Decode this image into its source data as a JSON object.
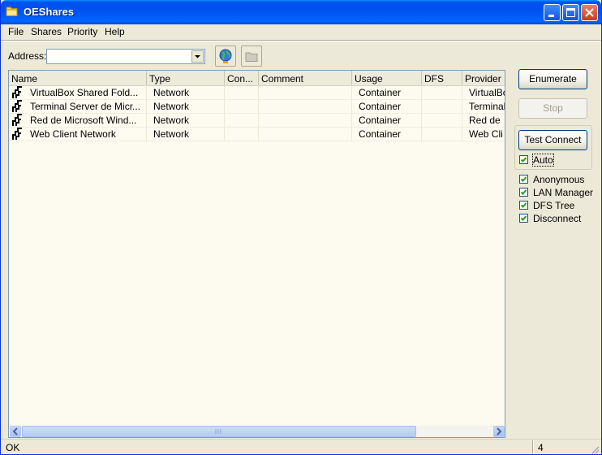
{
  "window": {
    "title": "OEShares"
  },
  "menu": [
    "File",
    "Shares",
    "Priority",
    "Help"
  ],
  "address": {
    "label": "Address:",
    "value": "",
    "placeholder": ""
  },
  "columns": [
    "Name",
    "Type",
    "Con...",
    "Comment",
    "Usage",
    "DFS",
    "Provider"
  ],
  "rows": [
    {
      "name": "VirtualBox Shared Fold...",
      "type": "Network",
      "con": "",
      "comment": "",
      "usage": "Container",
      "dfs": "",
      "provider": "VirtualBo"
    },
    {
      "name": "Terminal Server de Micr...",
      "type": "Network",
      "con": "",
      "comment": "",
      "usage": "Container",
      "dfs": "",
      "provider": "Terminal"
    },
    {
      "name": "Red de Microsoft Wind...",
      "type": "Network",
      "con": "",
      "comment": "",
      "usage": "Container",
      "dfs": "",
      "provider": "Red de"
    },
    {
      "name": "Web Client Network",
      "type": "Network",
      "con": "",
      "comment": "",
      "usage": "Container",
      "dfs": "",
      "provider": "Web Cli"
    }
  ],
  "buttons": {
    "enumerate": "Enumerate",
    "stop": "Stop",
    "test_connect": "Test Connect"
  },
  "checks": [
    {
      "label": "Auto",
      "checked": true
    },
    {
      "label": "Anonymous",
      "checked": true
    },
    {
      "label": "LAN Manager",
      "checked": true
    },
    {
      "label": "DFS Tree",
      "checked": true
    },
    {
      "label": "Disconnect",
      "checked": true
    }
  ],
  "status": {
    "text": "OK",
    "count": "4"
  },
  "icons": [
    "folder-icon",
    "minimize-icon",
    "maximize-icon",
    "close-icon",
    "chevron-down-icon",
    "globe-icon",
    "folder-up-icon",
    "network-share-icon",
    "scroll-left-icon",
    "scroll-right-icon",
    "check-icon",
    "resize-grip-icon"
  ],
  "colors": {
    "titlebar": "#0053ee",
    "window": "#ece9d8",
    "list_bg": "#fdfbf0",
    "close_button": "#c83d18"
  }
}
